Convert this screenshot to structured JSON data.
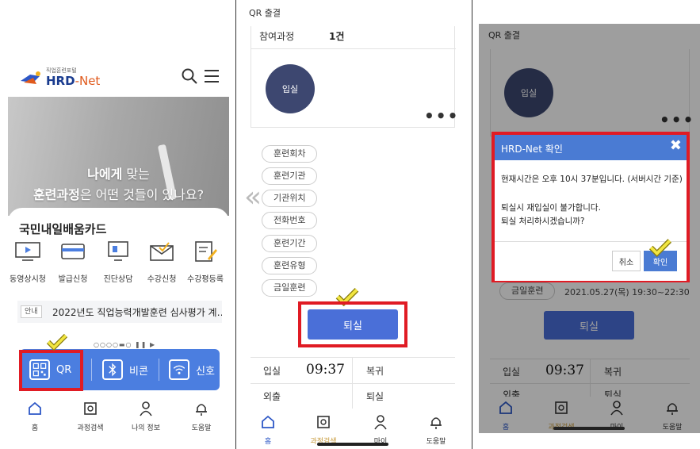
{
  "panel1": {
    "logo_sub": "직업훈련포털",
    "logo_main": "HRD",
    "logo_main2": "-Net",
    "hero_line1_bold": "나에게",
    "hero_line1_rest": " 맞는",
    "hero_line2_bold": "훈련과정",
    "hero_line2_rest": "은 어떤 것들이 있나요?",
    "card_title": "국민내일배움카드",
    "menu": [
      {
        "label": "동영상시청",
        "icon": "video-icon"
      },
      {
        "label": "발급신청",
        "icon": "card-icon"
      },
      {
        "label": "진단상담",
        "icon": "monitor-icon"
      },
      {
        "label": "수강신청",
        "icon": "mail-check-icon"
      },
      {
        "label": "수강평등록",
        "icon": "edit-icon"
      }
    ],
    "notice_tag": "안내",
    "notice_text": "2022년도 직업능력개발훈련 심사평가 계…",
    "pager_pause": "❚❚",
    "pager_play": "▶",
    "bluebar": {
      "qr": "QR",
      "beacon": "비콘",
      "signal": "신호"
    },
    "tabs": [
      {
        "label": "홈",
        "icon": "home-icon"
      },
      {
        "label": "과정검색",
        "icon": "search-doc-icon"
      },
      {
        "label": "나의 정보",
        "icon": "person-icon"
      },
      {
        "label": "도움말",
        "icon": "bell-icon"
      }
    ]
  },
  "panel2": {
    "title": "QR 출결",
    "participation_label": "참여과정",
    "participation_value": "1건",
    "checkin": "입실",
    "more": "•••",
    "pills": [
      "훈련회차",
      "훈련기관",
      "기관위치",
      "전화번호",
      "훈련기간",
      "훈련유형",
      "금일훈련"
    ],
    "checkout_button": "퇴실",
    "grid": {
      "in_label": "입실",
      "in_time": "09:37",
      "return_label": "복귀",
      "out_label": "외출",
      "checkout_label": "퇴실"
    },
    "tabs": [
      {
        "label": "홈",
        "icon": "home-icon"
      },
      {
        "label": "과정검색",
        "icon": "search-doc-icon"
      },
      {
        "label": "마이",
        "icon": "person-icon"
      },
      {
        "label": "도움말",
        "icon": "bell-icon"
      }
    ]
  },
  "panel3": {
    "title": "QR 출결",
    "checkin": "입실",
    "more": "•••",
    "dialog_title": "HRD-Net 확인",
    "dialog_close": "✖",
    "dialog_line1": "현재시간은 오후 10시 37분입니다. (서버시간 기준)",
    "dialog_line2": "퇴실시 재입실이 불가합니다.",
    "dialog_line3": "퇴실 처리하시겠습니까?",
    "cancel": "취소",
    "confirm": "확인",
    "today_pill": "금일훈련",
    "today_value": "2021.05.27(목) 19:30~22:30",
    "checkout_button": "퇴실",
    "grid": {
      "in_label": "입실",
      "in_time": "09:37",
      "return_label": "복귀",
      "out_label": "외출",
      "checkout_label": "퇴실"
    },
    "tabs": [
      {
        "label": "홈",
        "icon": "home-icon"
      },
      {
        "label": "과정검색",
        "icon": "search-doc-icon"
      },
      {
        "label": "마이",
        "icon": "person-icon"
      },
      {
        "label": "도움말",
        "icon": "bell-icon"
      }
    ]
  },
  "colors": {
    "accent": "#4a7bd3",
    "highlight": "#e01b24",
    "active_tab": "#c79a3a",
    "check": "#f2e640"
  }
}
